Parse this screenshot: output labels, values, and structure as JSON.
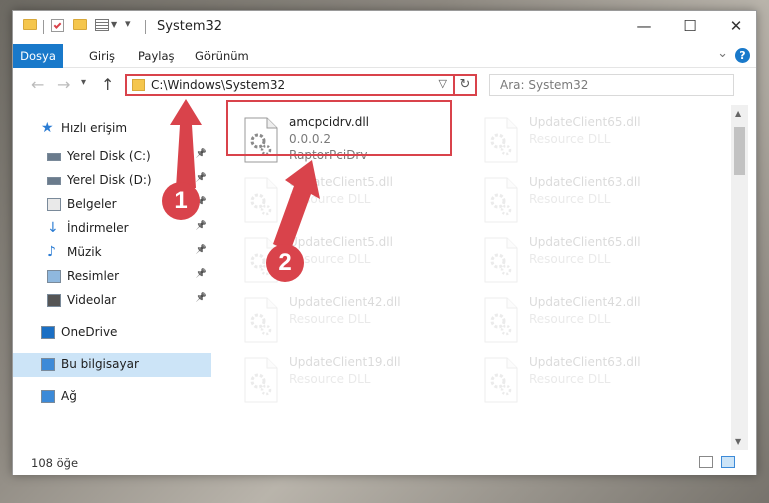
{
  "window": {
    "title": "System32",
    "minimize": "—",
    "maximize": "☐",
    "close": "✕"
  },
  "ribbon": {
    "tabs": [
      {
        "label": "Dosya"
      },
      {
        "label": "Giriş"
      },
      {
        "label": "Paylaş"
      },
      {
        "label": "Görünüm"
      }
    ],
    "help": "?"
  },
  "navbar": {
    "address": "C:\\Windows\\System32",
    "search_placeholder": "Ara: System32"
  },
  "sidebar": {
    "items": [
      {
        "label": "Hızlı erişim",
        "icon": "star-icon"
      },
      {
        "label": "Yerel Disk (C:)",
        "icon": "drive-icon",
        "pinned": true
      },
      {
        "label": "Yerel Disk (D:)",
        "icon": "drive-icon",
        "pinned": true
      },
      {
        "label": "Belgeler",
        "icon": "documents-icon",
        "pinned": true
      },
      {
        "label": "İndirmeler",
        "icon": "downloads-icon",
        "pinned": true
      },
      {
        "label": "Müzik",
        "icon": "music-icon",
        "pinned": true
      },
      {
        "label": "Resimler",
        "icon": "pictures-icon",
        "pinned": true
      },
      {
        "label": "Videolar",
        "icon": "videos-icon",
        "pinned": true
      },
      {
        "label": "OneDrive",
        "icon": "onedrive-icon"
      },
      {
        "label": "Bu bilgisayar",
        "icon": "computer-icon",
        "selected": true
      },
      {
        "label": "Ağ",
        "icon": "network-icon"
      }
    ]
  },
  "files": [
    {
      "name": "amcpcidrv.dll",
      "version": "0.0.0.2",
      "desc": "RaptorPciDrv",
      "faded": false
    },
    {
      "name": "UpdateClient65.dll",
      "desc": "Resource DLL",
      "faded": true
    },
    {
      "name": "UpdateClient5.dll",
      "desc": "Resource DLL",
      "faded": true
    },
    {
      "name": "UpdateClient63.dll",
      "desc": "Resource DLL",
      "faded": true
    },
    {
      "name": "UpdateClient5.dll",
      "desc": "Resource DLL",
      "faded": true
    },
    {
      "name": "UpdateClient65.dll",
      "desc": "Resource DLL",
      "faded": true
    },
    {
      "name": "UpdateClient42.dll",
      "desc": "Resource DLL",
      "faded": true
    },
    {
      "name": "UpdateClient42.dll",
      "desc": "Resource DLL",
      "faded": true
    },
    {
      "name": "UpdateClient19.dll",
      "desc": "Resource DLL",
      "faded": true
    },
    {
      "name": "UpdateClient63.dll",
      "desc": "Resource DLL",
      "faded": true
    }
  ],
  "status": {
    "count": "108 öğe"
  },
  "annotations": {
    "step1": "1",
    "step2": "2",
    "color": "#d9434b"
  }
}
